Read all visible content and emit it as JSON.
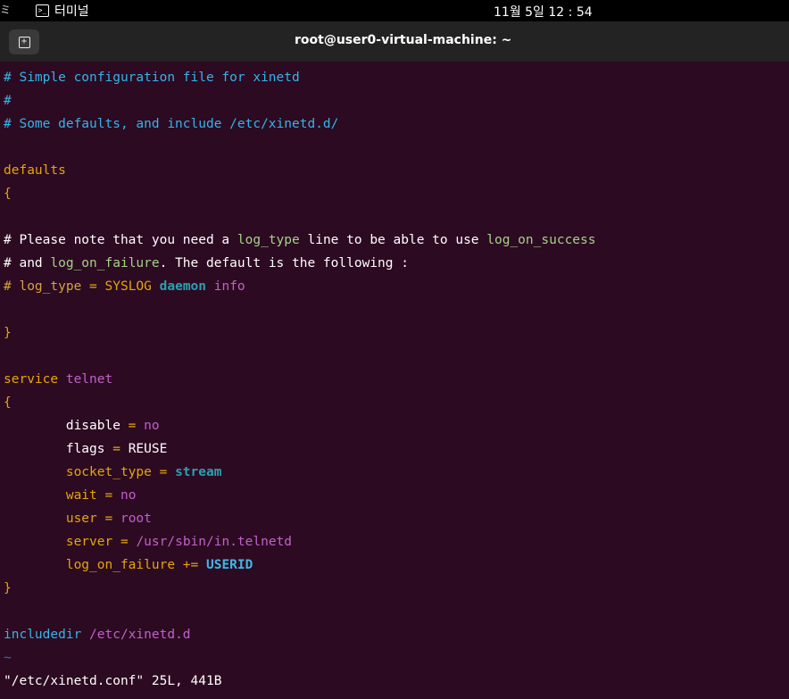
{
  "topbar": {
    "edge": "ミ",
    "app_name": "터미널",
    "clock": "11월 5일  12 : 54"
  },
  "window": {
    "title": "root@user0-virtual-machine: ~"
  },
  "editor": {
    "lines": [
      [
        {
          "t": "# Simple configuration file for xinetd",
          "k": "c"
        }
      ],
      [
        {
          "t": "#",
          "k": "c"
        }
      ],
      [
        {
          "t": "# Some defaults, and include /etc/xinetd.d/",
          "k": "c"
        }
      ],
      [],
      [
        {
          "t": "defaults",
          "k": "o"
        }
      ],
      [
        {
          "t": "{",
          "k": "o"
        }
      ],
      [],
      [
        {
          "t": "# Please note that you need a ",
          "k": ""
        },
        {
          "t": "log_type",
          "k": "g"
        },
        {
          "t": " line to be able to use ",
          "k": ""
        },
        {
          "t": "log_on_success",
          "k": "g"
        }
      ],
      [
        {
          "t": "# and ",
          "k": ""
        },
        {
          "t": "log_on_failure",
          "k": "g"
        },
        {
          "t": ". The default is the following :",
          "k": ""
        }
      ],
      [
        {
          "t": "# log_type",
          "k": "y"
        },
        {
          "t": " = ",
          "k": "o"
        },
        {
          "t": "SYSLOG ",
          "k": "o"
        },
        {
          "t": "daemon",
          "k": "b"
        },
        {
          "t": " info",
          "k": "p"
        }
      ],
      [],
      [
        {
          "t": "}",
          "k": "o"
        }
      ],
      [],
      [
        {
          "t": "service",
          "k": "o"
        },
        {
          "t": " telnet",
          "k": "p"
        }
      ],
      [
        {
          "t": "{",
          "k": "o"
        }
      ],
      [
        {
          "t": "        ",
          "k": ""
        },
        {
          "t": "disable",
          "k": ""
        },
        {
          "t": " = ",
          "k": "o"
        },
        {
          "t": "no",
          "k": "p"
        }
      ],
      [
        {
          "t": "        ",
          "k": ""
        },
        {
          "t": "flags",
          "k": ""
        },
        {
          "t": " = ",
          "k": "o"
        },
        {
          "t": "REUSE",
          "k": ""
        }
      ],
      [
        {
          "t": "        ",
          "k": ""
        },
        {
          "t": "socket_type",
          "k": "o"
        },
        {
          "t": " = ",
          "k": "o"
        },
        {
          "t": "stream",
          "k": "b"
        }
      ],
      [
        {
          "t": "        ",
          "k": ""
        },
        {
          "t": "wait",
          "k": "o"
        },
        {
          "t": " = ",
          "k": "o"
        },
        {
          "t": "no",
          "k": "p"
        }
      ],
      [
        {
          "t": "        ",
          "k": ""
        },
        {
          "t": "user",
          "k": "o"
        },
        {
          "t": " = ",
          "k": "o"
        },
        {
          "t": "root",
          "k": "p"
        }
      ],
      [
        {
          "t": "        ",
          "k": ""
        },
        {
          "t": "server",
          "k": "o"
        },
        {
          "t": " = ",
          "k": "o"
        },
        {
          "t": "/usr/sbin/in.telnetd",
          "k": "p"
        }
      ],
      [
        {
          "t": "        ",
          "k": ""
        },
        {
          "t": "log_on_failure",
          "k": "o"
        },
        {
          "t": " += ",
          "k": "o"
        },
        {
          "t": "USERID",
          "k": "bb"
        }
      ],
      [
        {
          "t": "}",
          "k": "o"
        }
      ],
      [],
      [
        {
          "t": "includedir",
          "k": "c"
        },
        {
          "t": " /etc/xinetd.d",
          "k": "p"
        }
      ],
      [
        {
          "t": "~",
          "k": "tilde"
        }
      ]
    ],
    "status_line": "\"/etc/xinetd.conf\" 25L, 441B"
  },
  "colors": {
    "background": "#2c0a21",
    "comment": "#34b4eb",
    "keyword": "#e5a50a",
    "value": "#c061cb",
    "bold_value": "#2aa1b3"
  }
}
